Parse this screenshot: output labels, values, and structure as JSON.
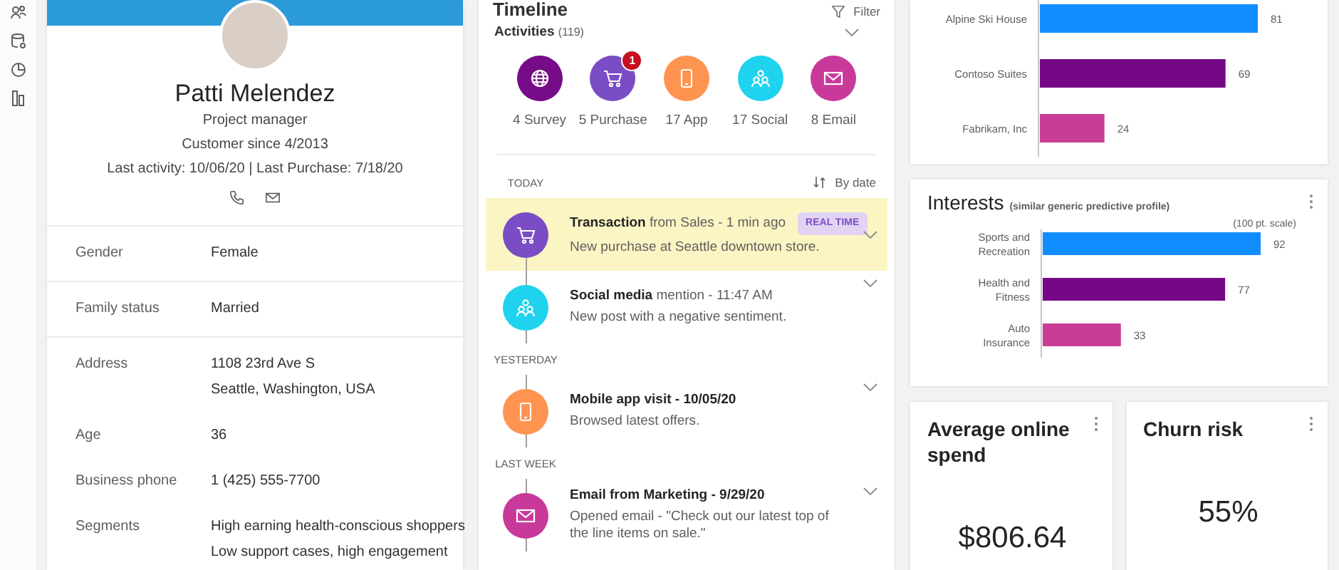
{
  "profile": {
    "name": "Patti Melendez",
    "role": "Project manager",
    "customer_since": "Customer since 4/2013",
    "last_activity": "Last activity: 10/06/20 | Last Purchase: 7/18/20",
    "sections": [
      [
        {
          "label": "Gender",
          "values": [
            "Female"
          ]
        }
      ],
      [
        {
          "label": "Family status",
          "values": [
            "Married"
          ]
        }
      ],
      [
        {
          "label": "Address",
          "values": [
            "1108 23rd Ave S",
            "Seattle, Washington, USA"
          ]
        },
        {
          "label": "Age",
          "values": [
            "36"
          ]
        },
        {
          "label": "Business phone",
          "values": [
            "1 (425) 555-7700"
          ]
        },
        {
          "label": "Segments",
          "values": [
            "High earning health-conscious shoppers",
            "Low support cases, high engagement"
          ]
        }
      ]
    ]
  },
  "timeline": {
    "title": "Timeline",
    "filter": "Filter",
    "activities_label": "Activities",
    "activities_count": "(119)",
    "activities": [
      {
        "kind": "survey",
        "color": "#760c87",
        "label": "4 Survey"
      },
      {
        "kind": "purchase",
        "color": "#7a4dc4",
        "label": "5 Purchase",
        "badge": "1"
      },
      {
        "kind": "app",
        "color": "#ff9350",
        "label": "17 App"
      },
      {
        "kind": "social",
        "color": "#1fd3ee",
        "label": "17 Social"
      },
      {
        "kind": "email",
        "color": "#c8399a",
        "label": "8 Email"
      }
    ],
    "sort": "By date",
    "groups": [
      {
        "label": "TODAY",
        "items": [
          {
            "kind": "purchase",
            "color": "#7a4dc4",
            "title": "**Transaction** from Sales - 1 min ago",
            "bold": false,
            "badge": "REAL TIME",
            "description": "New purchase at Seattle downtown store.",
            "highlighted": true
          },
          {
            "kind": "social",
            "color": "#1fd3ee",
            "title": "**Social media** mention - 11:47 AM",
            "bold": false,
            "description": "New post with a negative sentiment.",
            "highlighted": false
          }
        ]
      },
      {
        "label": "YESTERDAY",
        "items": [
          {
            "kind": "app",
            "color": "#ff9350",
            "title": "Mobile app visit - 10/05/20",
            "bold": true,
            "description": "Browsed latest offers.",
            "highlighted": false
          }
        ]
      },
      {
        "label": "LAST WEEK",
        "items": [
          {
            "kind": "email",
            "color": "#c8399a",
            "title": "Email from Marketing - 9/29/20",
            "bold": true,
            "description": "Opened email - \"Check out our latest top of the line items on sale.\"",
            "highlighted": false
          }
        ]
      }
    ]
  },
  "charts": [
    {
      "chart_data": {
        "type": "bar",
        "orientation": "horizontal",
        "categories": [
          "Alpine Ski House",
          "Contoso Suites",
          "Fabrikam, Inc"
        ],
        "values": [
          81,
          69,
          24
        ],
        "colors": [
          "#118dff",
          "#750985",
          "#c83d95"
        ],
        "data_labels": true
      }
    },
    {
      "title": "Interests",
      "subtitle": "(similar generic predictive profile)",
      "scale_note": "(100 pt. scale)",
      "chart_data": {
        "type": "bar",
        "orientation": "horizontal",
        "categories": [
          "Sports and Recreation",
          "Health and Fitness",
          "Auto Insurance"
        ],
        "values": [
          92,
          77,
          33
        ],
        "colors": [
          "#118dff",
          "#750985",
          "#c83d95"
        ],
        "data_labels": true
      }
    }
  ],
  "kpis": [
    {
      "title": "Average online spend",
      "value": "$806.64"
    },
    {
      "title": "Churn risk",
      "value": "55%"
    }
  ]
}
